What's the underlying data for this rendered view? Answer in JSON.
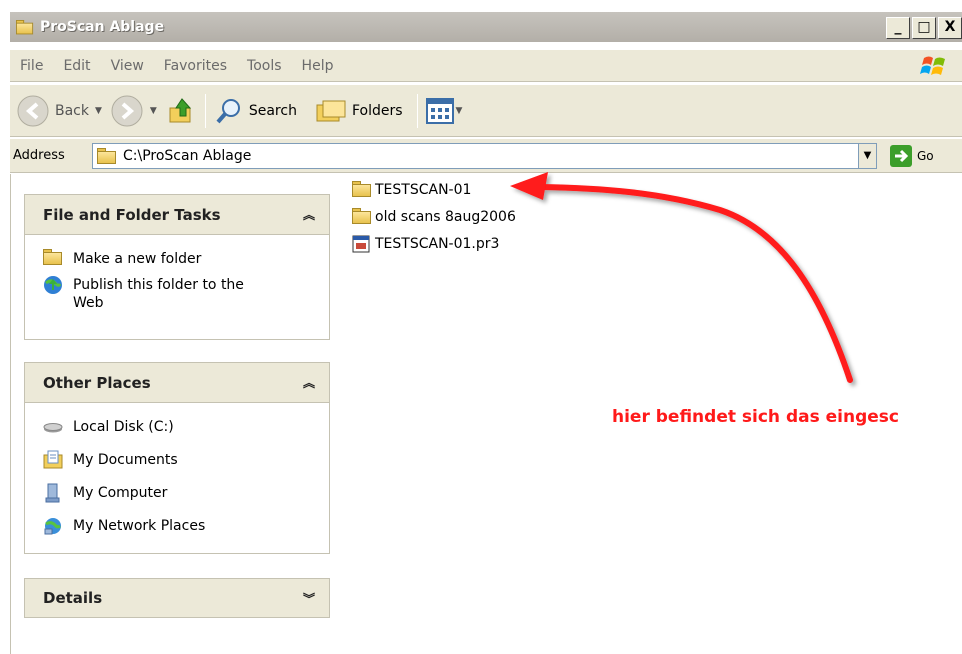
{
  "window": {
    "title": "ProScan Ablage",
    "buttons": {
      "minimize": "_",
      "maximize": "□",
      "close": "X"
    }
  },
  "menu": {
    "items": [
      "File",
      "Edit",
      "View",
      "Favorites",
      "Tools",
      "Help"
    ]
  },
  "toolbar": {
    "back_label": "Back",
    "search_label": "Search",
    "folders_label": "Folders"
  },
  "address": {
    "label": "Address",
    "value": "C:\\ProScan Ablage",
    "go_label": "Go"
  },
  "tasks_panel": {
    "title": "File and Folder Tasks",
    "items": [
      {
        "label": "Make a new folder",
        "icon": "new-folder-icon"
      },
      {
        "label": "Publish this folder to the Web",
        "icon": "publish-web-icon"
      }
    ]
  },
  "places_panel": {
    "title": "Other Places",
    "items": [
      {
        "label": "Local Disk (C:)",
        "icon": "local-disk-icon"
      },
      {
        "label": "My Documents",
        "icon": "my-documents-icon"
      },
      {
        "label": "My Computer",
        "icon": "my-computer-icon"
      },
      {
        "label": "My Network Places",
        "icon": "network-places-icon"
      }
    ]
  },
  "details_panel": {
    "title": "Details"
  },
  "files": [
    {
      "name": "TESTSCAN-01",
      "type": "folder"
    },
    {
      "name": "old scans 8aug2006",
      "type": "folder"
    },
    {
      "name": "TESTSCAN-01.pr3",
      "type": "file"
    }
  ],
  "annotation": {
    "text": "hier befindet sich das eingesc",
    "color": "#ff1a1a"
  }
}
